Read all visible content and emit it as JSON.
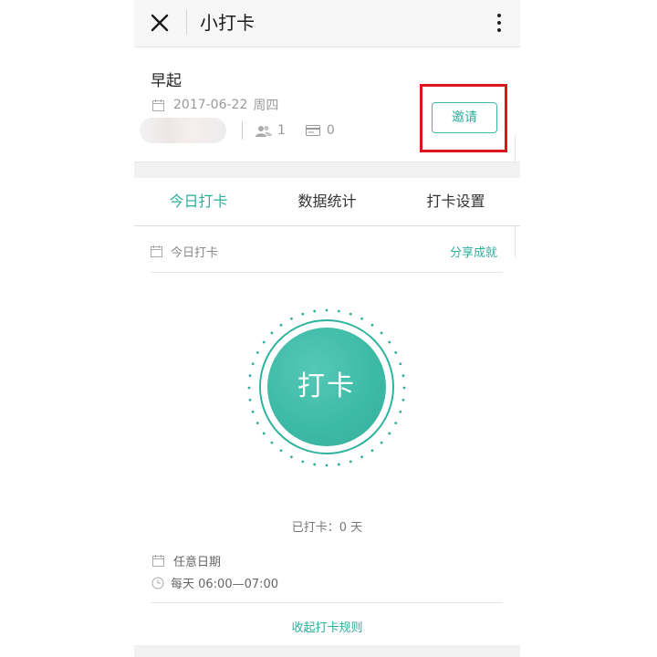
{
  "topbar": {
    "title": "小打卡",
    "close_icon": "close-icon",
    "more_icon": "more-vertical-icon"
  },
  "group": {
    "name": "早起",
    "date": "2017-06-22",
    "weekday": "周四",
    "members_count": "1",
    "cards_count": "0",
    "invite_label": "邀请"
  },
  "tabs": [
    {
      "label": "今日打卡",
      "active": true
    },
    {
      "label": "数据统计",
      "active": false
    },
    {
      "label": "打卡设置",
      "active": false
    }
  ],
  "today_section": {
    "label": "今日打卡",
    "share_label": "分享成就"
  },
  "punch": {
    "label": "打卡",
    "streak_text": "已打卡：0 天"
  },
  "rules": {
    "date_rule": "任意日期",
    "time_rule": "每天 06:00—07:00",
    "collapse_label": "收起打卡规则"
  },
  "colors": {
    "accent": "#2fae9b",
    "highlight": "#e0141b"
  }
}
